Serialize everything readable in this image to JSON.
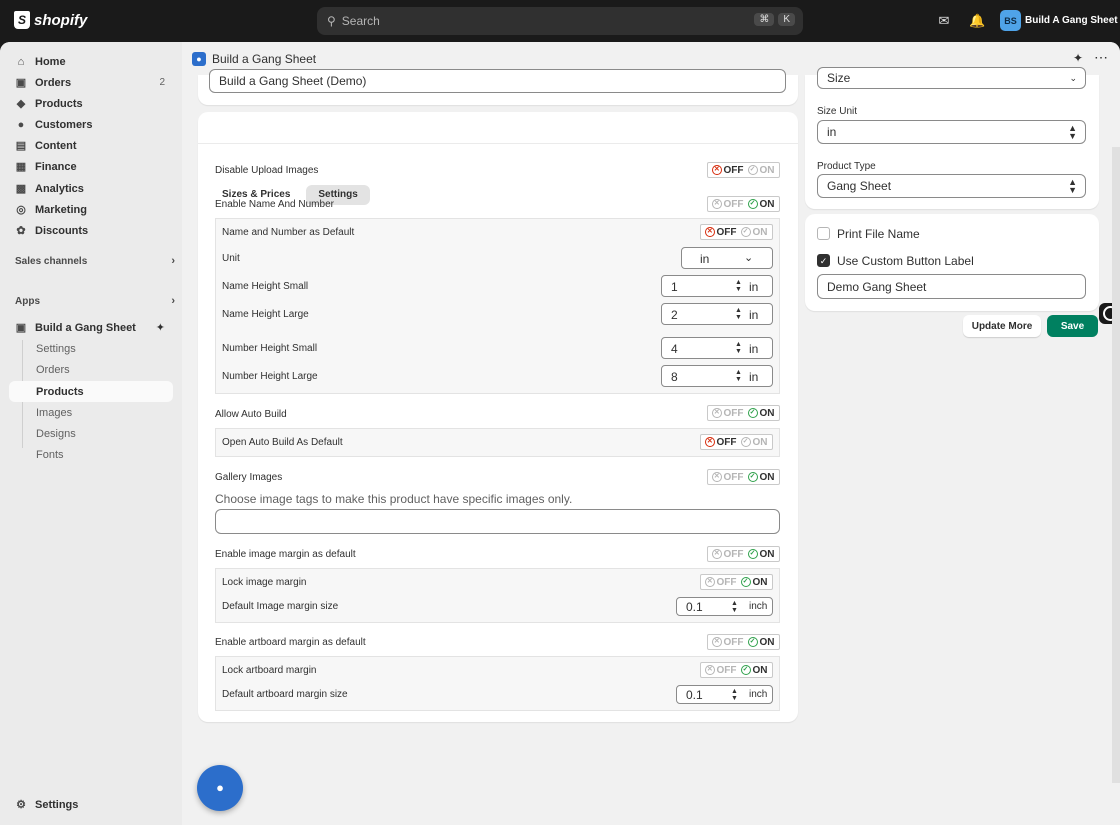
{
  "topbar": {
    "logo_text": "shopify",
    "search_placeholder": "Search",
    "kbd_cmd": "⌘",
    "kbd_k": "K",
    "store_initials": "BS",
    "store_name": "Build A Gang Sheet"
  },
  "sidebar": {
    "items": [
      {
        "label": "Home",
        "icon": "home-icon"
      },
      {
        "label": "Orders",
        "icon": "orders-icon",
        "badge": "2"
      },
      {
        "label": "Products",
        "icon": "tag-icon"
      },
      {
        "label": "Customers",
        "icon": "person-icon"
      },
      {
        "label": "Content",
        "icon": "content-icon"
      },
      {
        "label": "Finance",
        "icon": "bank-icon"
      },
      {
        "label": "Analytics",
        "icon": "chart-icon"
      },
      {
        "label": "Marketing",
        "icon": "target-icon"
      },
      {
        "label": "Discounts",
        "icon": "discount-icon"
      }
    ],
    "sales_channels": "Sales channels",
    "apps": "Apps",
    "app_name": "Build a Gang Sheet",
    "app_sub": [
      "Settings",
      "Orders",
      "Products",
      "Images",
      "Designs",
      "Fonts"
    ],
    "settings": "Settings"
  },
  "app_header": {
    "title": "Build a Gang Sheet"
  },
  "main": {
    "title_field": "Build a Gang Sheet (Demo)",
    "tabs": [
      "Sizes & Prices",
      "Settings"
    ],
    "active_tab": "Settings",
    "toggle_off": "OFF",
    "toggle_on": "ON",
    "disable_upload": "Disable Upload Images",
    "enable_name_number": "Enable Name And Number",
    "name_number_default": "Name and Number as Default",
    "unit_label": "Unit",
    "unit_value": "in",
    "name_height_small": "Name Height Small",
    "name_height_small_val": "1",
    "name_height_large": "Name Height Large",
    "name_height_large_val": "2",
    "number_height_small": "Number Height Small",
    "number_height_small_val": "4",
    "number_height_large": "Number Height Large",
    "number_height_large_val": "8",
    "in": "in",
    "allow_auto_build": "Allow Auto Build",
    "open_auto_build": "Open Auto Build As Default",
    "gallery_images": "Gallery Images",
    "gallery_desc": "Choose image tags to make this product have specific images only.",
    "enable_image_margin": "Enable image margin as default",
    "lock_image_margin": "Lock image margin",
    "default_image_margin": "Default Image margin size",
    "image_margin_val": "0.1",
    "inch": "inch",
    "enable_artboard_margin": "Enable artboard margin as default",
    "lock_artboard_margin": "Lock artboard margin",
    "default_artboard_margin": "Default artboard margin size",
    "artboard_margin_val": "0.1"
  },
  "right": {
    "size_select": "Size",
    "size_unit_label": "Size Unit",
    "size_unit_value": "in",
    "product_type_label": "Product Type",
    "product_type_value": "Gang Sheet",
    "print_file_name": "Print File Name",
    "print_file_name_checked": false,
    "use_custom_label": "Use Custom Button Label",
    "use_custom_label_checked": true,
    "button_label_value": "Demo Gang Sheet",
    "update_more": "Update More",
    "save": "Save"
  },
  "colors": {
    "accent_green": "#008060",
    "on_green": "#2fa14b",
    "off_red": "#d72c0d",
    "app_blue": "#2c6ecb"
  }
}
